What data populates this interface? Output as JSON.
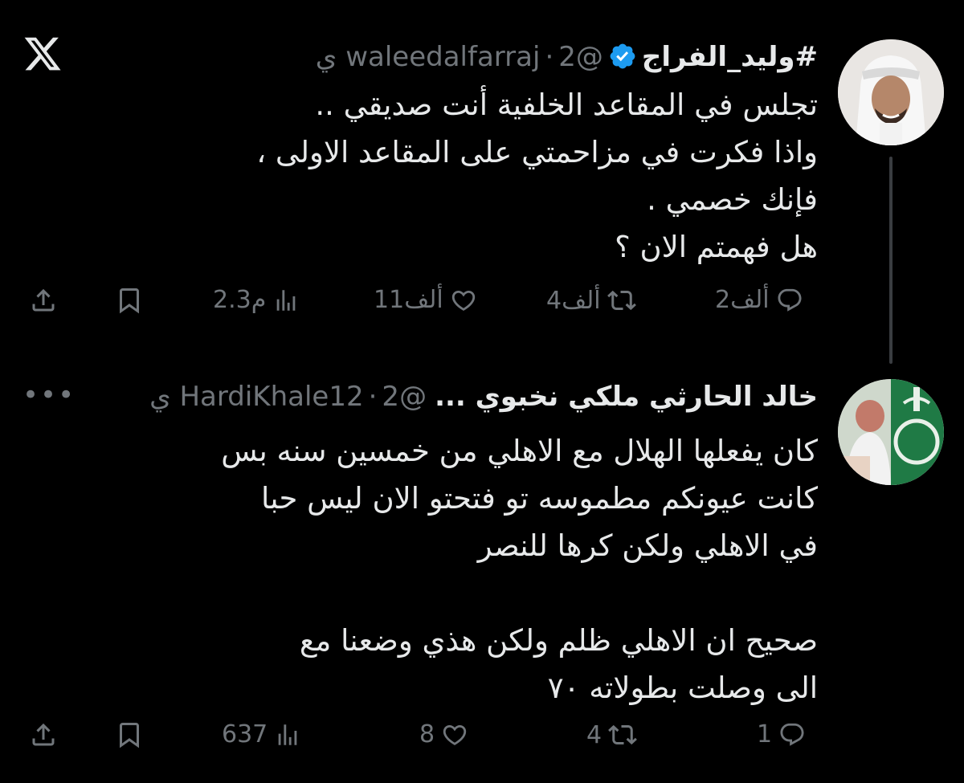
{
  "tweets": [
    {
      "name": "#وليد_الفراج",
      "handle": "@waleedalfarraj",
      "time": "2 ي",
      "verified": true,
      "text": "تجلس في المقاعد الخلفية أنت صديقي ..\nواذا فكرت في مزاحمتي على المقاعد الاولى ،\nفإنك خصمي .\nهل فهمتم الان ؟",
      "replies": "2ألف",
      "retweets": "4ألف",
      "likes": "11ألف",
      "views": "2.3م"
    },
    {
      "name": "خالد الحارثي ملكي نخبوي ...",
      "handle": "@HardiKhale12",
      "time": "2 ي",
      "verified": false,
      "text": "كان يفعلها الهلال مع الاهلي من خمسين سنه بس\nكانت  عيونكم مطموسه تو فتحتو  الان ليس حبا\nفي الاهلي ولكن كرها للنصر\n\nصحيح ان الاهلي ظلم ولكن هذي وضعنا مع\nالى وصلت بطولاته ٧٠",
      "replies": "1",
      "retweets": "4",
      "likes": "8",
      "views": "637"
    }
  ],
  "separator": "·",
  "more_label": "•••",
  "icons": {
    "logo": "x-logo-icon",
    "verified": "verified-badge-icon",
    "reply": "reply-icon",
    "retweet": "retweet-icon",
    "like": "like-icon",
    "views": "views-icon",
    "bookmark": "bookmark-icon",
    "share": "share-icon"
  },
  "colors": {
    "background": "#000000",
    "text": "#e7e9ea",
    "muted": "#71767b",
    "verified": "#1d9bf0",
    "thread_line": "#3a3d41"
  }
}
